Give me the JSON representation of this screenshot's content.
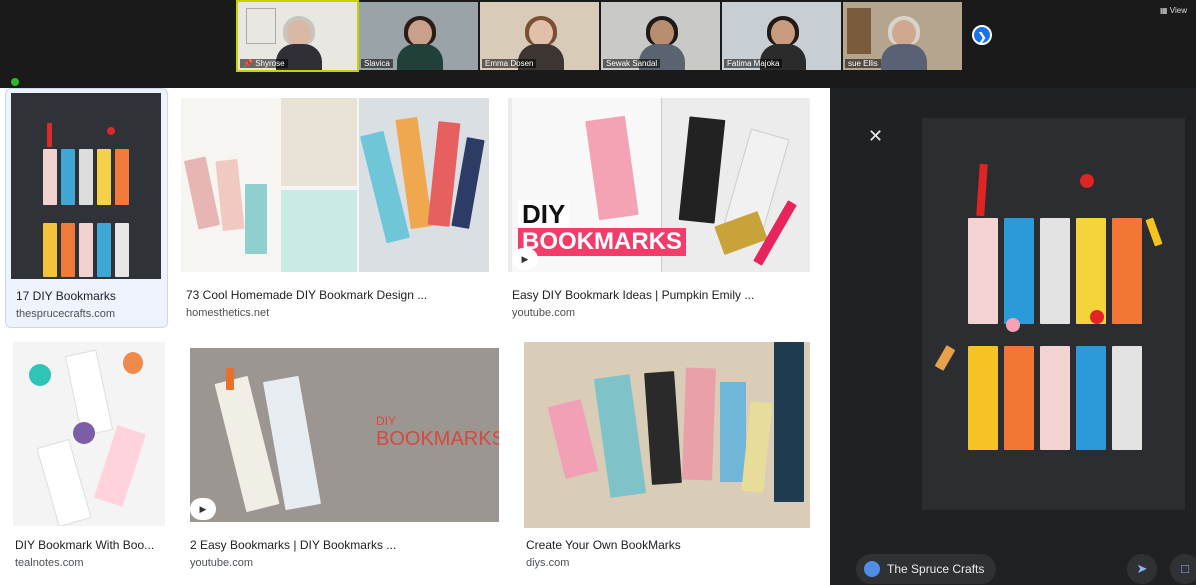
{
  "meeting": {
    "participants": [
      {
        "name": "Shyrose",
        "active": true,
        "pinned": true
      },
      {
        "name": "Slavica",
        "active": false,
        "pinned": false
      },
      {
        "name": "Emma Dosen",
        "active": false,
        "pinned": false
      },
      {
        "name": "Sewak Sandal",
        "active": false,
        "pinned": false
      },
      {
        "name": "Fatima Majoka",
        "active": false,
        "pinned": false
      },
      {
        "name": "sue Ellis",
        "active": false,
        "pinned": false
      }
    ],
    "next_icon": "chevron-right-icon",
    "view_label": "View",
    "pin_icon": "pin-icon",
    "security_icon": "shield-icon"
  },
  "results": [
    {
      "title": "17 DIY Bookmarks",
      "source": "thesprucecrafts.com",
      "selected": true,
      "video": false
    },
    {
      "title": "73 Cool Homemade DIY Bookmark Design ...",
      "source": "homesthetics.net",
      "selected": false,
      "video": false
    },
    {
      "title": "Easy DIY Bookmark Ideas | Pumpkin Emily ...",
      "source": "youtube.com",
      "selected": false,
      "video": true,
      "overlay_lines": [
        "DIY",
        "BOOKMARKS"
      ]
    },
    {
      "title": "DIY Bookmark With Boo...",
      "source": "tealnotes.com",
      "selected": false,
      "video": false
    },
    {
      "title": "2 Easy Bookmarks | DIY Bookmarks ...",
      "source": "youtube.com",
      "selected": false,
      "video": true,
      "overlay_lines": [
        "DIY",
        "BOOKMARKS"
      ]
    },
    {
      "title": "Create Your Own BookMarks",
      "source": "diys.com",
      "selected": false,
      "video": false
    }
  ],
  "preview": {
    "close_icon": "close-icon",
    "site_name": "The Spruce Crafts",
    "globe_icon": "globe-icon",
    "share_icon": "share-icon",
    "save_icon": "bookmark-icon"
  },
  "colors": {
    "active_tile_border": "#c8d200",
    "accent_blue": "#1a73e8",
    "selected_card_bg": "#eef3fd",
    "preview_bg": "#202124"
  }
}
